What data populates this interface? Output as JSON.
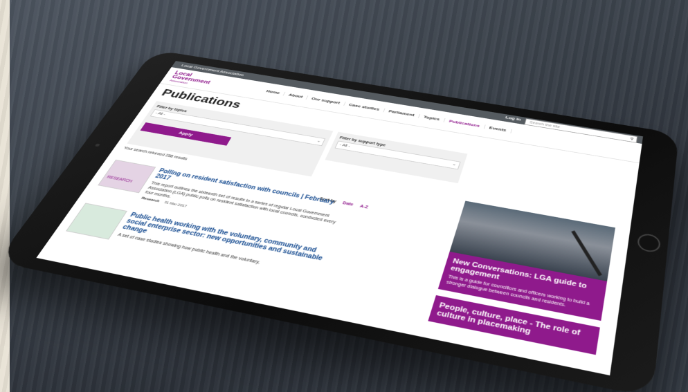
{
  "site": {
    "topbar_title": "Local Government Association",
    "logo_line1": "Local",
    "logo_line2": "Government",
    "logo_line3": "Association",
    "login_label": "Log in",
    "search_placeholder": "Search the site"
  },
  "nav": [
    "Home",
    "About",
    "Our support",
    "Case studies",
    "Parliament",
    "Topics",
    "Publications",
    "Events"
  ],
  "page_title": "Publications",
  "filters": {
    "topics_label": "Filter by topics",
    "topics_value": "- All -",
    "apply_label": "Apply",
    "support_label": "Filter by support type",
    "support_value": "- All -"
  },
  "results_text": "Your search returned 258 results",
  "sort": {
    "label": "Sort by",
    "date": "Date",
    "az": "A-Z"
  },
  "items": [
    {
      "thumb_text": "RESEARCH",
      "title": "Polling on resident satisfaction with councils | February 2017",
      "desc": "This report outlines the sixteenth set of results in a series of regular Local Government Association (LGA) public polls on resident satisfaction with local councils, conducted every four months.",
      "type": "Research",
      "date": "31 Mar 2017"
    },
    {
      "thumb_text": "",
      "title": "Public health working with the voluntary, community and social enterprise sector: new opportunities and sustainable change",
      "desc": "A set of case studies showing how public health and the voluntary,",
      "type": "",
      "date": ""
    }
  ],
  "cards": [
    {
      "title": "New Conversations: LGA guide to engagement",
      "desc": "This is a guide for councillors and officers working to build a stronger dialogue between councils and residents."
    },
    {
      "title": "People, culture, place - The role of culture in placemaking",
      "desc": ""
    }
  ],
  "colors": {
    "brand": "#8f1a8c",
    "link": "#13498f"
  }
}
